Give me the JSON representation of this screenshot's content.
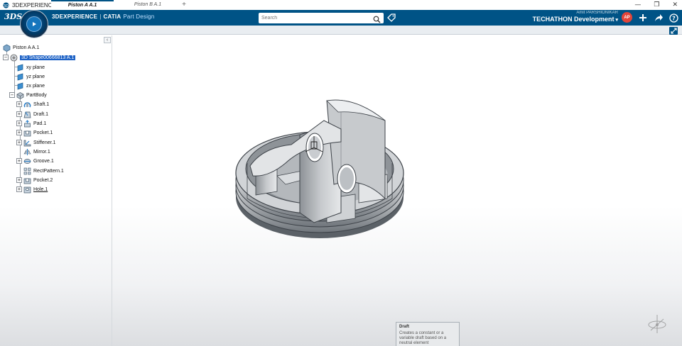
{
  "window": {
    "title": "3DEXPERIENCE",
    "controls": [
      "—",
      "❐",
      "✕"
    ]
  },
  "header": {
    "brand_main": "3DEXPERIENCE",
    "brand_sep": "|",
    "brand_product": "CATIA",
    "brand_app": "Part Design",
    "search_placeholder": "Search",
    "user_name": "Amit PARSHIONIKAR",
    "collab_space": "TECHATHON Development",
    "avatar_text": "AP",
    "colors": {
      "header_bg": "#005386",
      "selection": "#1f63c6",
      "avatar": "#e2453a"
    }
  },
  "tabs": [
    {
      "label": "Piston A A.1",
      "active": true
    },
    {
      "label": "Piston B A.1",
      "active": false
    }
  ],
  "tab_add_label": "+",
  "tree": {
    "root": "Piston A A.1",
    "shape": "3D Shape00666813 A.1",
    "planes": [
      "xy plane",
      "yz plane",
      "zx plane"
    ],
    "body": "PartBody",
    "features": [
      "Shaft.1",
      "Draft.1",
      "Pad.1",
      "Pocket.1",
      "Stiffener.1",
      "Mirror.1",
      "Groove.1",
      "RectPattern.1",
      "Pocket.2",
      "Hole.1"
    ]
  },
  "collapse_label": "‹",
  "tooltip": {
    "title": "Draft",
    "text": "Creates a constant or a variable draft based on a neutral element"
  }
}
